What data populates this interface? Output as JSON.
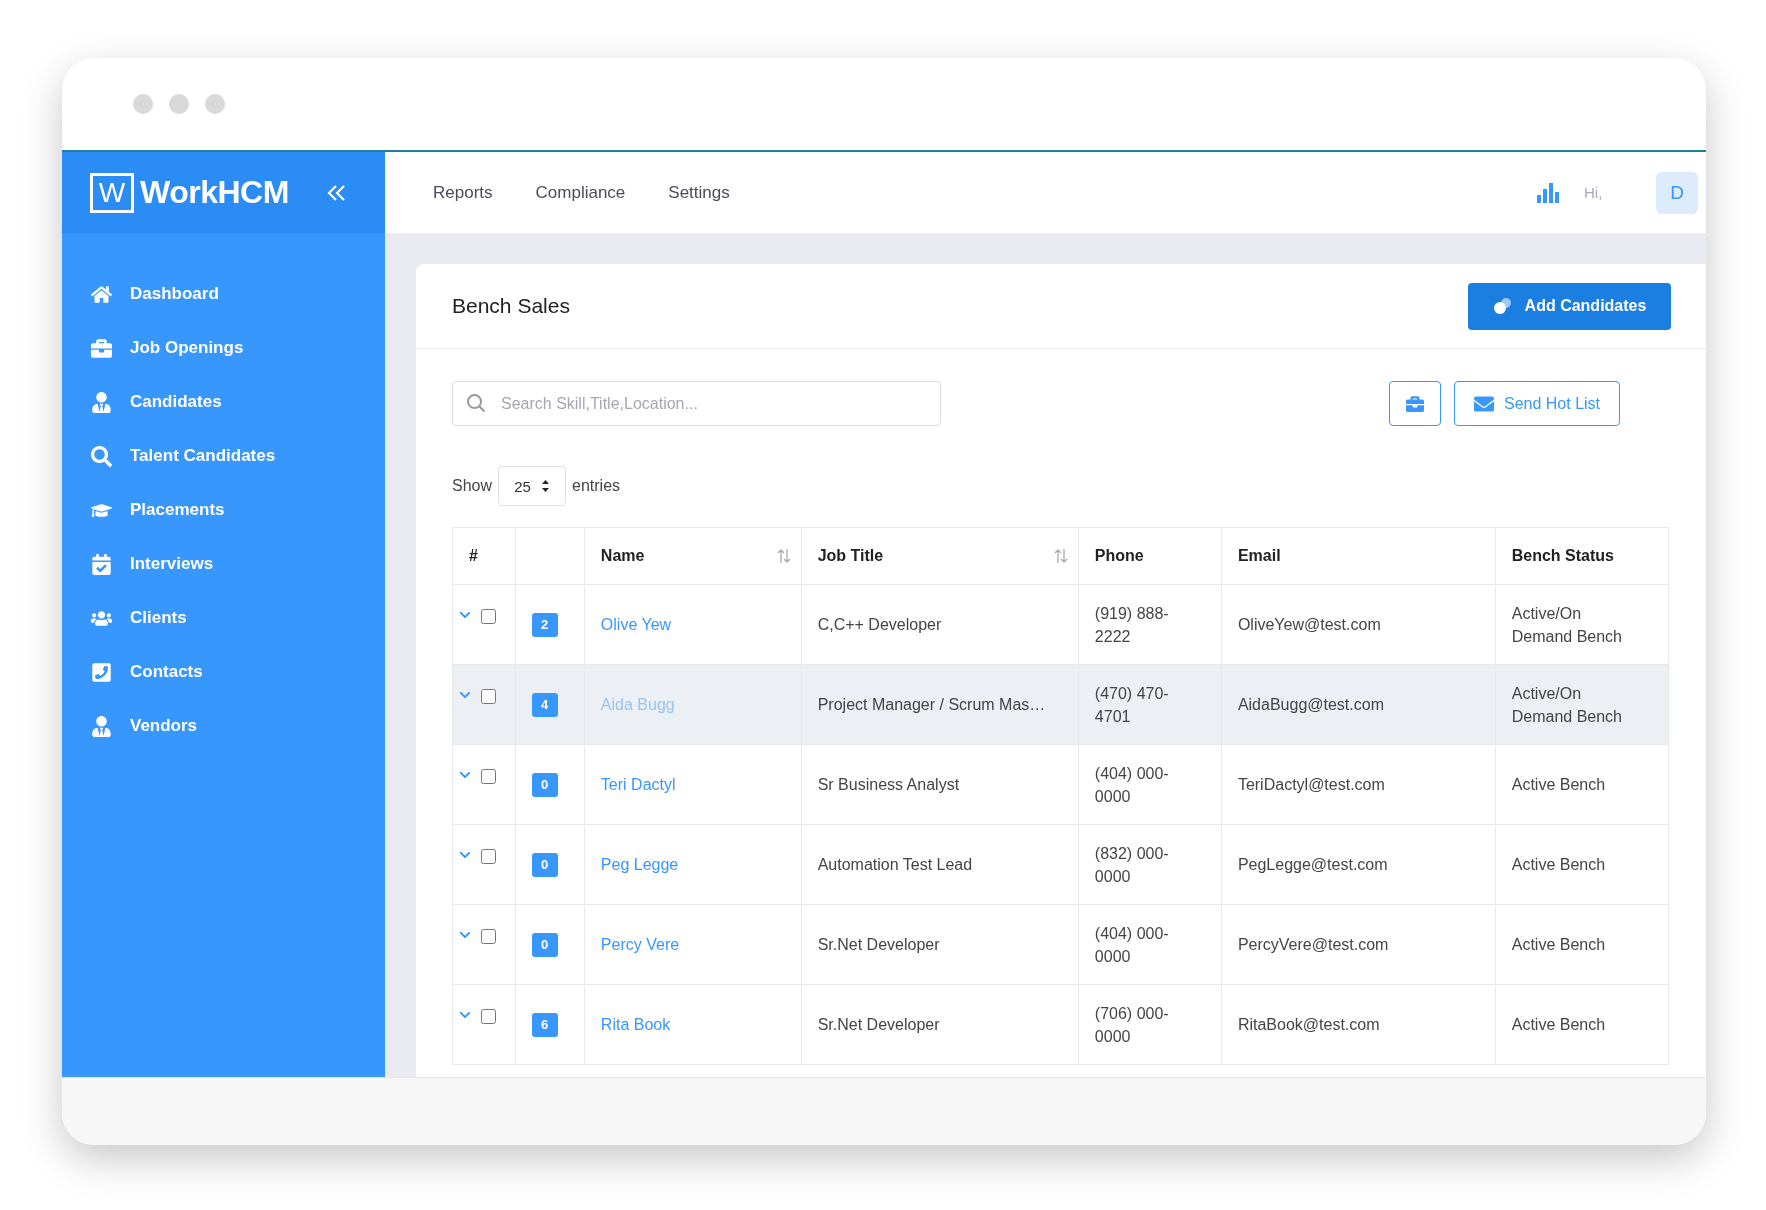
{
  "brand": {
    "letter": "W",
    "name": "WorkHCM"
  },
  "sidebar": {
    "items": [
      {
        "label": "Dashboard"
      },
      {
        "label": "Job Openings"
      },
      {
        "label": "Candidates"
      },
      {
        "label": "Talent Candidates"
      },
      {
        "label": "Placements"
      },
      {
        "label": "Interviews"
      },
      {
        "label": "Clients"
      },
      {
        "label": "Contacts"
      },
      {
        "label": "Vendors"
      }
    ]
  },
  "top_nav": {
    "links": [
      "Reports",
      "Compliance",
      "Settings"
    ],
    "greeting": "Hi,",
    "avatar": "D"
  },
  "page": {
    "title": "Bench Sales",
    "add_button": "Add Candidates",
    "search": {
      "placeholder": "Search Skill,Title,Location..."
    },
    "send_button": "Send Hot List",
    "show": {
      "before": "Show",
      "value": "25",
      "after": "entries"
    }
  },
  "table": {
    "columns": [
      {
        "label": "#",
        "sortable": false
      },
      {
        "label": "Name",
        "sortable": true
      },
      {
        "label": "Job Title",
        "sortable": true
      },
      {
        "label": "Phone",
        "sortable": false
      },
      {
        "label": "Email",
        "sortable": false
      },
      {
        "label": "Bench Status",
        "sortable": false
      }
    ],
    "rows": [
      {
        "count": "2",
        "name": "Olive Yew",
        "job_title": "C,C++ Developer",
        "phone": "(919) 888-2222",
        "email": "OliveYew@test.com",
        "bench_status": "Active/On Demand Bench",
        "checked": false,
        "selected": false
      },
      {
        "count": "4",
        "name": "Aida Bugg",
        "job_title": "Project Manager / Scrum Mas…",
        "phone": "(470) 470-4701",
        "email": "AidaBugg@test.com",
        "bench_status": "Active/On Demand Bench",
        "checked": false,
        "selected": true
      },
      {
        "count": "0",
        "name": "Teri Dactyl",
        "job_title": "Sr Business Analyst",
        "phone": "(404) 000-0000",
        "email": "TeriDactyl@test.com",
        "bench_status": "Active Bench",
        "checked": false,
        "selected": false
      },
      {
        "count": "0",
        "name": "Peg Legge",
        "job_title": "Automation Test Lead",
        "phone": "(832) 000-0000",
        "email": "PegLegge@test.com",
        "bench_status": "Active Bench",
        "checked": false,
        "selected": false
      },
      {
        "count": "0",
        "name": "Percy Vere",
        "job_title": "Sr.Net Developer",
        "phone": "(404) 000-0000",
        "email": "PercyVere@test.com",
        "bench_status": "Active Bench",
        "checked": false,
        "selected": false
      },
      {
        "count": "6",
        "name": "Rita Book",
        "job_title": "Sr.Net Developer",
        "phone": "(706) 000-0000",
        "email": "RitaBook@test.com",
        "bench_status": "Active Bench",
        "checked": false,
        "selected": false
      }
    ]
  }
}
